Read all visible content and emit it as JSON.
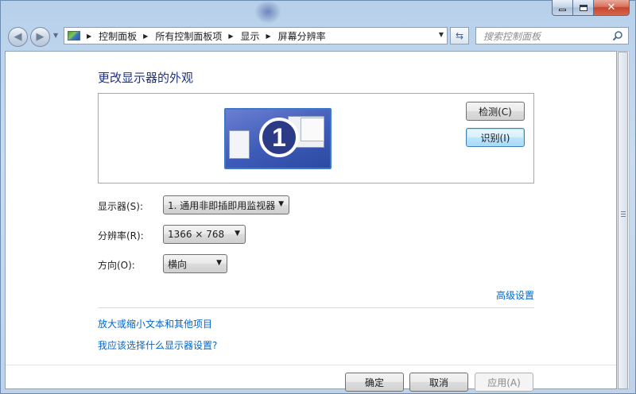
{
  "window": {
    "minimize_glyph": "minimize-icon",
    "maximize_glyph": "maximize-icon",
    "close_glyph": "✕"
  },
  "nav": {
    "back_icon": "back-arrow-icon",
    "forward_icon": "forward-arrow-icon",
    "breadcrumbs": [
      "控制面板",
      "所有控制面板项",
      "显示",
      "屏幕分辨率"
    ],
    "refresh_icon": "refresh-icon",
    "search_placeholder": "搜索控制面板"
  },
  "page": {
    "title": "更改显示器的外观",
    "monitor_number": "1",
    "detect_button": "检测(C)",
    "identify_button": "识别(I)",
    "display_label": "显示器(S):",
    "display_value": "1. 通用非即插即用监视器",
    "resolution_label": "分辨率(R):",
    "resolution_value": "1366 × 768",
    "orientation_label": "方向(O):",
    "orientation_value": "横向",
    "advanced_link": "高级设置",
    "links": [
      "放大或缩小文本和其他项目",
      "我应该选择什么显示器设置?"
    ],
    "ok_button": "确定",
    "cancel_button": "取消",
    "apply_button": "应用(A)"
  },
  "colors": {
    "title": "#1e3287",
    "link": "#0066cc",
    "monitor_bg": "#3e5bb9"
  }
}
